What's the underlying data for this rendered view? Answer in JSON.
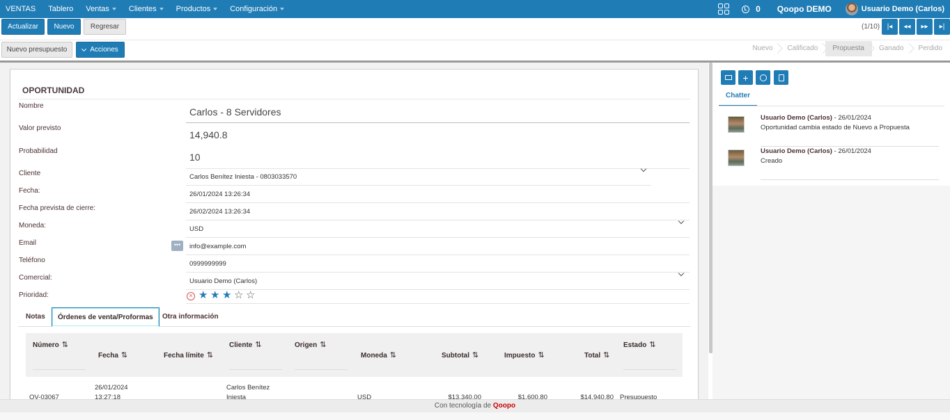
{
  "topbar": {
    "menu": [
      {
        "label": "VENTAS",
        "caret": false
      },
      {
        "label": "Tablero",
        "caret": false
      },
      {
        "label": "Ventas",
        "caret": true
      },
      {
        "label": "Clientes",
        "caret": true
      },
      {
        "label": "Productos",
        "caret": true
      },
      {
        "label": "Configuración",
        "caret": true
      }
    ],
    "activity_count": "0",
    "company": "Qoopo DEMO",
    "user": "Usuario Demo (Carlos)"
  },
  "toolbar": {
    "refresh": "Actualizar",
    "new": "Nuevo",
    "back": "Regresar",
    "new_quote": "Nuevo presupuesto",
    "actions": "Acciones",
    "pager": "(1/10)"
  },
  "stages": [
    "Nuevo",
    "Calificado",
    "Propuesta",
    "Ganado",
    "Perdido"
  ],
  "active_stage": "Propuesta",
  "form": {
    "title": "OPORTUNIDAD",
    "labels": {
      "name": "Nombre",
      "expected_value": "Valor previsto",
      "probability": "Probabilidad",
      "customer": "Cliente",
      "date": "Fecha:",
      "close_date": "Fecha prevista de cierre:",
      "currency": "Moneda:",
      "email": "Email",
      "phone": "Teléfono",
      "salesperson": "Comercial:",
      "priority": "Prioridad:"
    },
    "values": {
      "name": "Carlos - 8 Servidores",
      "expected_value": "14,940.8",
      "probability": "10",
      "customer": "Carlos Benítez Iniesta - 0803033570",
      "date": "26/01/2024 13:26:34",
      "close_date": "26/02/2024 13:26:34",
      "currency": "USD",
      "email": "info@example.com",
      "phone": "0999999999",
      "salesperson": "Usuario Demo (Carlos)"
    },
    "priority_stars": 3,
    "priority_max": 5
  },
  "tabs": {
    "notes": "Notas",
    "orders": "Órdenes de venta/Proformas",
    "other": "Otra información"
  },
  "orders_table": {
    "columns": {
      "number": "Número",
      "date": "Fecha",
      "deadline": "Fecha límite",
      "customer": "Cliente",
      "origin": "Origen",
      "currency": "Moneda",
      "subtotal": "Subtotal",
      "tax": "Impuesto",
      "total": "Total",
      "state": "Estado"
    },
    "rows": [
      {
        "number": "OV-03067",
        "date_1": "26/01/2024",
        "date_2": "13:27:18",
        "deadline": "",
        "customer_1": "Carlos Benítez",
        "customer_2": "Iniesta",
        "origin": "",
        "currency": "USD",
        "subtotal": "$13,340.00",
        "tax": "$1,600.80",
        "total": "$14,940.80",
        "state": "Presupuesto"
      }
    ]
  },
  "chatter": {
    "tab": "Chatter",
    "messages": [
      {
        "author": "Usuario Demo (Carlos)",
        "date": "- 26/01/2024",
        "body": "Oportunidad cambia estado de Nuevo a Propuesta"
      },
      {
        "author": "Usuario Demo (Carlos)",
        "date": "- 26/01/2024",
        "body": "Creado"
      }
    ]
  },
  "footer": {
    "prefix": "Con tecnología de",
    "brand": "Qoopo"
  },
  "colors": {
    "primary": "#1f7cb5",
    "brand_red": "#cc0000"
  }
}
